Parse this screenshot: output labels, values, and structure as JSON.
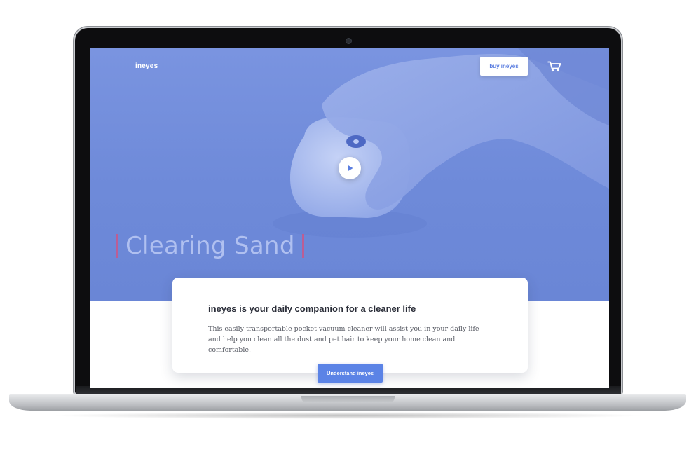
{
  "header": {
    "logo_text": "ineyes",
    "buy_button_label": "buy ineyes",
    "cart_icon": "cart-icon"
  },
  "hero": {
    "headline": "Clearing Sand",
    "play_icon": "play-icon",
    "accent_color": "#c9578a",
    "background_color": "#7a94e0"
  },
  "card": {
    "title": "ineyes is your daily companion for a cleaner life",
    "body": "This easily transportable pocket vacuum cleaner will assist you in your daily life and help you clean all the dust and pet hair to keep your home clean and comfortable."
  },
  "cta": {
    "label": "Understand ineyes",
    "color": "#5b83e6"
  }
}
